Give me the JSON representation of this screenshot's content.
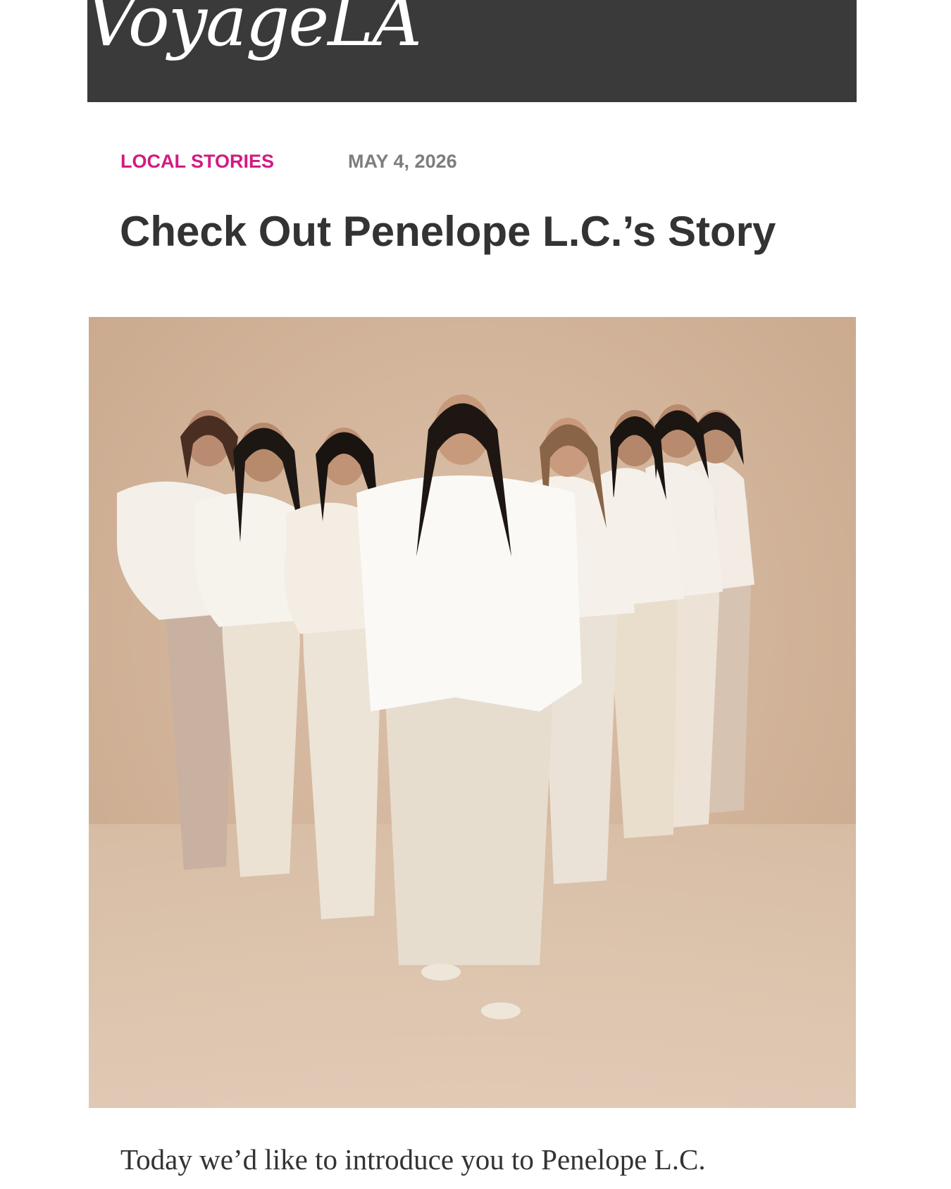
{
  "site": {
    "logo": "VoyageLA"
  },
  "article": {
    "category": "LOCAL STORIES",
    "date": "MAY 4, 2026",
    "title": "Check Out Penelope L.C.’s Story",
    "intro": "Today we’d like to introduce you to Penelope L.C."
  },
  "colors": {
    "header_bg": "#3a3a3a",
    "category": "#d21a83",
    "date": "#7d7d7d",
    "title": "#333333",
    "photo_backdrop": "#d2b49b"
  },
  "photo": {
    "people_count": 8
  }
}
